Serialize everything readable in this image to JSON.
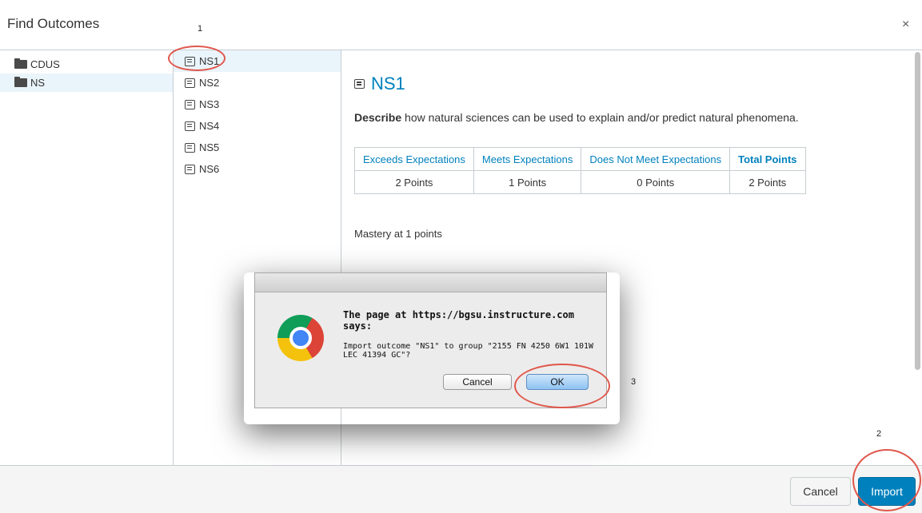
{
  "dialog": {
    "title": "Find Outcomes",
    "close_label": "×"
  },
  "annotations": [
    "1",
    "2",
    "3"
  ],
  "groups": [
    {
      "label": "CDUS",
      "icon": "folder-icon"
    },
    {
      "label": "NS",
      "icon": "folder-icon",
      "selected": true
    }
  ],
  "outcomes": [
    {
      "label": "NS1",
      "icon": "outcome-icon",
      "selected": true
    },
    {
      "label": "NS2",
      "icon": "outcome-icon"
    },
    {
      "label": "NS3",
      "icon": "outcome-icon"
    },
    {
      "label": "NS4",
      "icon": "outcome-icon"
    },
    {
      "label": "NS5",
      "icon": "outcome-icon"
    },
    {
      "label": "NS6",
      "icon": "outcome-icon"
    }
  ],
  "detail": {
    "title": "NS1",
    "desc_bold": "Describe",
    "desc_rest": " how natural sciences can be used to explain and/or predict natural phenomena.",
    "rubric_headers": [
      "Exceeds Expectations",
      "Meets Expectations",
      "Does Not Meet Expectations",
      "Total Points"
    ],
    "rubric_values": [
      "2 Points",
      "1 Points",
      "0 Points",
      "2 Points"
    ],
    "mastery": "Mastery at 1 points"
  },
  "footer": {
    "cancel_label": "Cancel",
    "import_label": "Import"
  },
  "alert": {
    "heading": "The page at https://bgsu.instructure.com says:",
    "message": "Import outcome \"NS1\" to group \"2155 FN 4250 6W1 101W LEC 41394 GC\"?",
    "cancel_label": "Cancel",
    "ok_label": "OK"
  },
  "colors": {
    "accent": "#0081bd",
    "annotation_circle": "#e0574c",
    "selected_bg": "#eaf4fb"
  }
}
